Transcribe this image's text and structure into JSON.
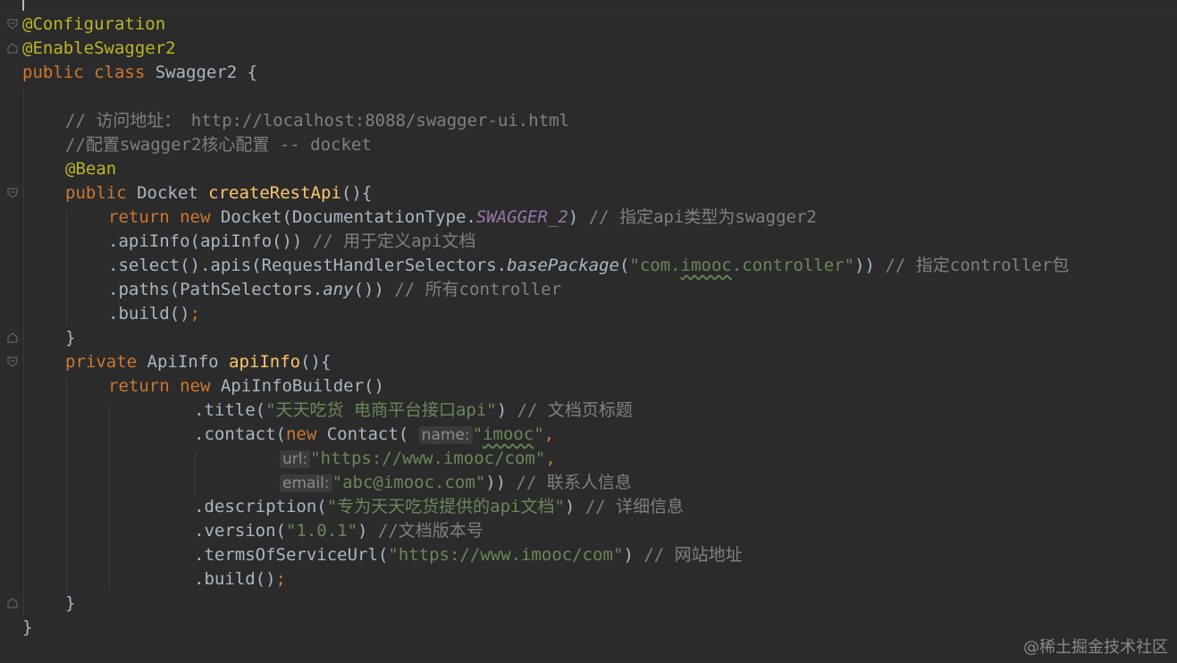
{
  "lines": [
    "@Configuration",
    "@EnableSwagger2",
    "public class Swagger2 {",
    "",
    "// 访问地址： http://localhost:8088/swagger-ui.html",
    "//配置swagger2核心配置 -- docket",
    "@Bean",
    "public Docket createRestApi(){",
    "return new Docket(DocumentationType.SWAGGER_2) // 指定api类型为swagger2",
    ".apiInfo(apiInfo()) // 用于定义api文档",
    ".select().apis(RequestHandlerSelectors.basePackage(\"com.imooc.controller\")) // 指定controller包",
    ".paths(PathSelectors.any()) // 所有controller",
    ".build();",
    "}",
    "private ApiInfo apiInfo(){",
    "return new ApiInfoBuilder()",
    ".title(\"天天吃货 电商平台接口api\") // 文档页标题",
    ".contact(new Contact( name: \"imooc\",",
    "url: \"https://www.imooc/com\",",
    "email: \"abc@imooc.com\")) // 联系人信息",
    ".description(\"专为天天吃货提供的api文档\") // 详细信息",
    ".version(\"1.0.1\") //文档版本号",
    ".termsOfServiceUrl(\"https://www.imooc/com\") // 网站地址",
    ".build();",
    "}",
    "}"
  ],
  "code": {
    "l1": "@Configuration",
    "l2": "@EnableSwagger2",
    "l3_kw1": "public",
    "l3_kw2": "class",
    "l3_rest": " Swagger2 {",
    "l5_cm": "// 访问地址： http://localhost:8088/swagger-ui.html",
    "l6_cm": "//配置swagger2核心配置 -- docket",
    "l7": "@Bean",
    "l8_kw": "public",
    "l8_type": " Docket ",
    "l8_fn": "createRestApi",
    "l8_rest": "(){",
    "l9_kw1": "return",
    "l9_kw2": "new",
    "l9_a": " Docket(DocumentationType.",
    "l9_const": "SWAGGER_2",
    "l9_b": ") ",
    "l9_cm": "// 指定api类型为swagger2",
    "l10_a": ".apiInfo(apiInfo()) ",
    "l10_cm": "// 用于定义api文档",
    "l11_a": ".select().apis(RequestHandlerSelectors.",
    "l11_static": "basePackage",
    "l11_b": "(",
    "l11_str1": "\"com.",
    "l11_typo": "imooc",
    "l11_str2": ".controller\"",
    "l11_c": ")) ",
    "l11_cm": "// 指定controller包",
    "l12_a": ".paths(PathSelectors.",
    "l12_static": "any",
    "l12_b": "()) ",
    "l12_cm": "// 所有controller",
    "l13_a": ".build()",
    "l13_semi": ";",
    "l14": "}",
    "l15_kw": "private",
    "l15_type": " ApiInfo ",
    "l15_fn": "apiInfo",
    "l15_rest": "(){",
    "l16_kw1": "return",
    "l16_kw2": "new",
    "l16_rest": " ApiInfoBuilder()",
    "l17_a": ".title(",
    "l17_str": "\"天天吃货 电商平台接口api\"",
    "l17_b": ") ",
    "l17_cm": "// 文档页标题",
    "l18_a": ".contact(",
    "l18_kw": "new",
    "l18_b": " Contact( ",
    "l18_hint": "name:",
    "l18_str1": "\"",
    "l18_typo": "imooc",
    "l18_str2": "\"",
    "l18_comma": ",",
    "l19_hint": "url:",
    "l19_str": "\"https://www.imooc/com\"",
    "l19_comma": ",",
    "l20_hint": "email:",
    "l20_str": "\"abc@imooc.com\"",
    "l20_b": ")) ",
    "l20_cm": "// 联系人信息",
    "l21_a": ".description(",
    "l21_str": "\"专为天天吃货提供的api文档\"",
    "l21_b": ") ",
    "l21_cm": "// 详细信息",
    "l22_a": ".version(",
    "l22_str": "\"1.0.1\"",
    "l22_b": ") ",
    "l22_cm": "//文档版本号",
    "l23_a": ".termsOfServiceUrl(",
    "l23_str": "\"https://www.imooc/com\"",
    "l23_b": ") ",
    "l23_cm": "// 网站地址",
    "l24_a": ".build()",
    "l24_semi": ";",
    "l25": "}",
    "l26": "}"
  },
  "watermark": "@稀土掘金技术社区",
  "colors": {
    "background": "#2b2b2b",
    "annotation": "#bbb529",
    "keyword": "#cc7832",
    "comment": "#808080",
    "string": "#6a8759",
    "function": "#ffc66d",
    "constant": "#9876aa",
    "text": "#a9b7c6"
  }
}
